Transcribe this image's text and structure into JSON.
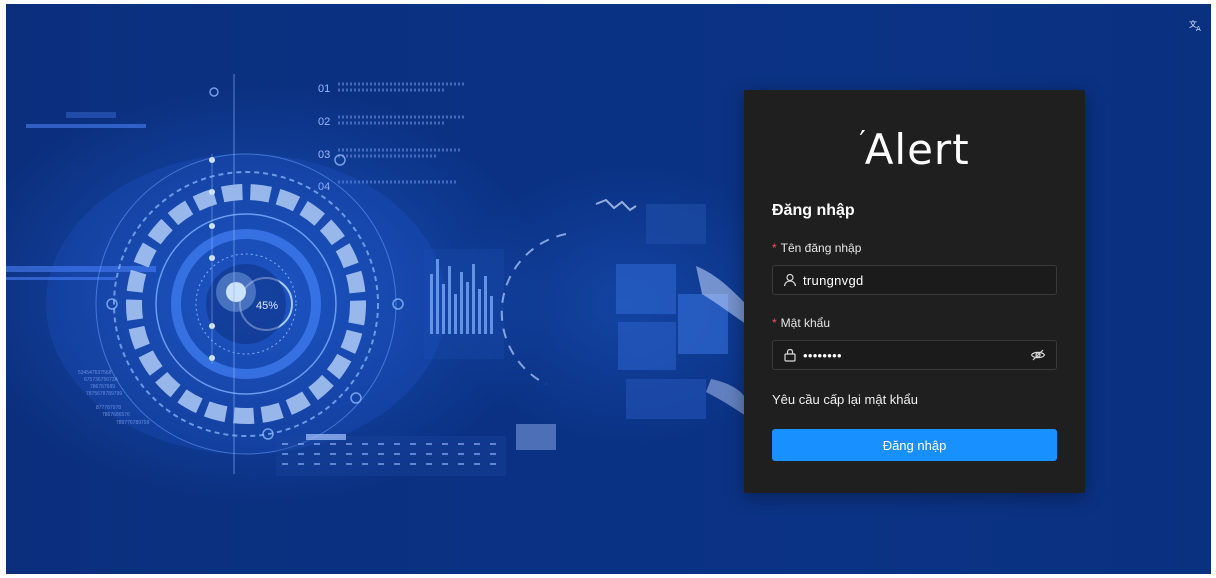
{
  "app": {
    "logo_text": "Alert",
    "logo_mark": "′",
    "translate_icon": "translate-icon"
  },
  "hero": {
    "percent_label": "45%",
    "line_numbers": [
      "01",
      "02",
      "03",
      "04"
    ]
  },
  "login": {
    "title": "Đăng nhập",
    "username_label": "Tên đăng nhập",
    "username_value": "trungnvgd",
    "password_label": "Mật khẩu",
    "password_mask": "••••••••",
    "forgot_link": "Yêu cầu cấp lại mật khẩu",
    "submit_label": "Đăng nhập",
    "required_mark": "*"
  },
  "colors": {
    "background": "#0a3183",
    "card": "#1f1f1f",
    "primary": "#1890ff",
    "required": "#ff4d4f"
  }
}
